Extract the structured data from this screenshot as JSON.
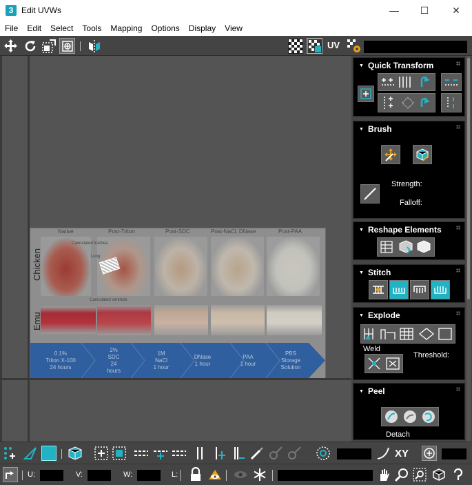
{
  "window": {
    "title": "Edit UVWs",
    "app_icon_text": "3",
    "minimize": "—",
    "maximize": "☐",
    "close": "✕"
  },
  "menu": [
    "File",
    "Edit",
    "Select",
    "Tools",
    "Mapping",
    "Options",
    "Display",
    "View"
  ],
  "toolbar_top": {
    "uv_label": "UV",
    "icons": [
      "move-icon",
      "rotate-icon",
      "scale-icon",
      "freeform-icon",
      "mirror-icon",
      "checker-pattern-icon",
      "checker-selected-icon",
      "uv-settings-icon"
    ]
  },
  "texture": {
    "columns": [
      "Native",
      "Post-Triton",
      "Post-SDC",
      "Post-NaCl, DNase",
      "Post-PAA"
    ],
    "rows": [
      "Chicken",
      "Emu"
    ],
    "annotations": [
      "Cannulated trachea",
      "Lung",
      "Cannulated ventricle"
    ],
    "steps": [
      "0.1%\nTriton X-100\n24 hours",
      "2%\nSDC\n24\nhours",
      "1M\nNaCl\n1 hour",
      "DNase\n1 hour",
      "PAA\n1 hour",
      "PBS\nStorage\nSolution"
    ]
  },
  "panel": {
    "quick_transform": {
      "title": "Quick Transform"
    },
    "brush": {
      "title": "Brush",
      "strength_label": "Strength:",
      "falloff_label": "Falloff:"
    },
    "reshape": {
      "title": "Reshape Elements"
    },
    "stitch": {
      "title": "Stitch"
    },
    "explode": {
      "title": "Explode",
      "weld_label": "Weld",
      "threshold_label": "Threshold:"
    },
    "peel": {
      "title": "Peel",
      "detach_label": "Detach"
    }
  },
  "toolbar_bottom": {
    "xy_label": "XY",
    "u_label": "U:",
    "v_label": "V:",
    "w_label": "W:",
    "l_label": "L:"
  },
  "colors": {
    "accent": "#21b3c4",
    "panel_bg": "#444444",
    "viewport_bg": "#545454",
    "rollout_bg": "#000000",
    "step_bar": "#2f5f9e"
  }
}
